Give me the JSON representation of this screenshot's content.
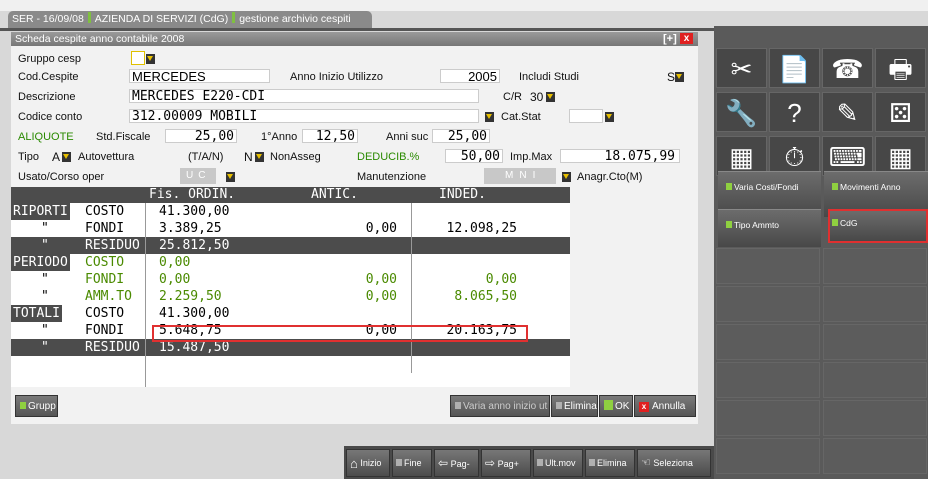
{
  "window": {
    "tab_title_parts": [
      "SER - 16/09/08",
      "AZIENDA DI SERVIZI (CdG)",
      "gestione archivio cespiti"
    ]
  },
  "dialog": {
    "title": "Scheda cespite anno contabile 2008",
    "max_glyph": "[+]",
    "close_glyph": "x"
  },
  "form": {
    "gruppo_label": "Gruppo cesp",
    "cod_label": "Cod.Cespite",
    "cod_value": "MERCEDES",
    "anno_label": "Anno Inizio Utilizzo",
    "anno_value": "2005",
    "includi_label": "Includi Studi",
    "includi_value": "S",
    "descr_label": "Descrizione",
    "descr_value": "MERCEDES E220-CDI",
    "cr_label": "C/R",
    "cr_value": "30",
    "conto_label": "Codice conto",
    "conto_value": "312.00009 MOBILI",
    "catstat_label": "Cat.Stat",
    "aliquote_label": "ALIQUOTE",
    "stdfiscale_label": "Std.Fiscale",
    "stdfiscale_value": "25,00",
    "primo_anno_label": "1°Anno",
    "primo_anno_value": "12,50",
    "anni_suc_label": "Anni suc",
    "anni_suc_value": "25,00",
    "tipo_label": "Tipo",
    "tipo_value": "A",
    "tipo_desc": "Autovettura",
    "tan_label": "(T/A/N)",
    "tan_value": "N",
    "nonasseg_label": "NonAsseg",
    "deducib_label": "DEDUCIB.%",
    "deducib_value": "50,00",
    "impmax_label": "Imp.Max",
    "impmax_value": "18.075,99",
    "usato_label": "Usato/Corso oper",
    "usato_opts": [
      "U",
      "C"
    ],
    "manut_label": "Manutenzione",
    "manut_opts": [
      "M",
      "N",
      "I"
    ],
    "anagr_label": "Anagr.Cto(M)"
  },
  "grid": {
    "headers": [
      "Fis. ORDIN.",
      "ANTIC.",
      "INDED."
    ],
    "rows": [
      {
        "a": "RIPORTI",
        "b": "COSTO",
        "ord": "41.300,00",
        "antic": "",
        "inded": "",
        "dark": false,
        "green": false
      },
      {
        "a": "\"",
        "b": "FONDI",
        "ord": "3.389,25",
        "antic": "0,00",
        "inded": "12.098,25",
        "dark": false,
        "green": false
      },
      {
        "a": "\"",
        "b": "RESIDUO",
        "ord": "25.812,50",
        "antic": "",
        "inded": "",
        "dark": true,
        "green": false
      },
      {
        "a": "PERIODO",
        "b": "COSTO",
        "ord": "0,00",
        "antic": "",
        "inded": "",
        "dark": false,
        "green": true
      },
      {
        "a": "\"",
        "b": "FONDI",
        "ord": "0,00",
        "antic": "0,00",
        "inded": "0,00",
        "dark": false,
        "green": true
      },
      {
        "a": "\"",
        "b": "AMM.TO",
        "ord": "2.259,50",
        "antic": "0,00",
        "inded": "8.065,50",
        "dark": false,
        "green": true
      },
      {
        "a": "TOTALI",
        "b": "COSTO",
        "ord": "41.300,00",
        "antic": "",
        "inded": "",
        "dark": false,
        "green": false
      },
      {
        "a": "\"",
        "b": "FONDI",
        "ord": "5.648,75",
        "antic": "0,00",
        "inded": "20.163,75",
        "dark": false,
        "green": false
      },
      {
        "a": "\"",
        "b": "RESIDUO",
        "ord": "15.487,50",
        "antic": "",
        "inded": "",
        "dark": true,
        "green": false
      }
    ]
  },
  "dialog_buttons": {
    "grupp": "Grupp",
    "varia": "Varia anno inizio ut",
    "elimina": "Elimina",
    "ok": "OK",
    "annulla": "Annulla"
  },
  "right_panel": {
    "icons": [
      "scissors-icon",
      "document-icon",
      "printer-fax-icon",
      "printer-icon",
      "wrench-icon",
      "help-icon",
      "notepad-icon",
      "dice-icon",
      "calculator-icon",
      "stopwatch-icon",
      "keyboard-icon",
      "grid-icon"
    ],
    "buttons": [
      "Varia Costi/Fondi",
      "Movimenti Anno",
      "Tipo Ammto",
      "CdG"
    ]
  },
  "bottom_bar": [
    "Inizio",
    "Fine",
    "Pag-",
    "Pag+",
    "Ult.mov",
    "Elimina",
    "Seleziona"
  ]
}
